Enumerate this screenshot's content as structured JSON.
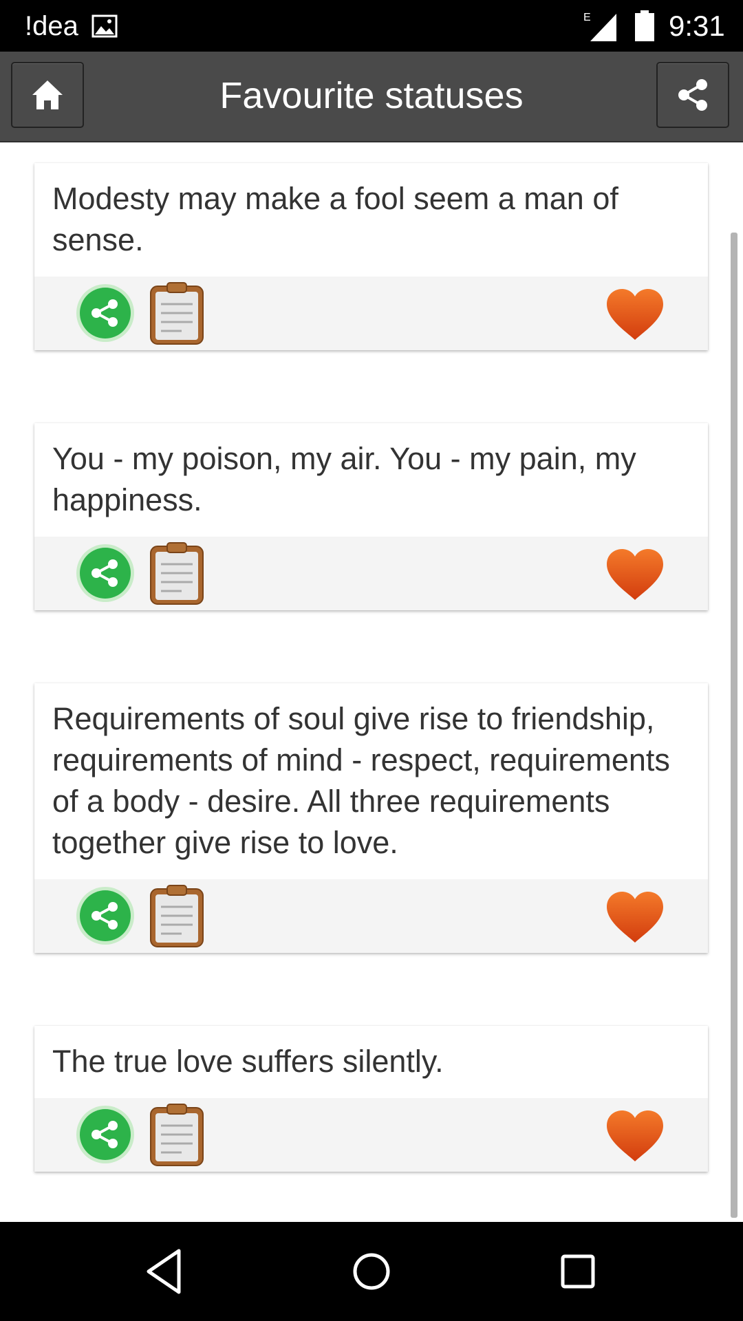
{
  "status_bar": {
    "carrier": "!dea",
    "network_type": "E",
    "time": "9:31",
    "icons": [
      "image-notification-icon",
      "signal-icon",
      "battery-icon"
    ]
  },
  "header": {
    "title": "Favourite statuses",
    "left_icon": "home-icon",
    "right_icon": "share-icon",
    "background_color": "#4a4a4a"
  },
  "statuses": [
    {
      "text": "Modesty may make a fool seem a man of sense."
    },
    {
      "text": "You - my poison, my air. You - my pain, my happiness."
    },
    {
      "text": "Requirements of soul give rise to friendship, requirements of mind - respect, requirements of a body - desire. All three requirements together give rise to love."
    },
    {
      "text": "The true love suffers silently."
    }
  ],
  "card_actions": {
    "icons": [
      "share-icon",
      "clipboard-icon",
      "heart-icon"
    ],
    "share_color": "#2db34a",
    "heart_color": "#e8561c"
  },
  "nav_bar": {
    "icons": [
      "back-icon",
      "home-circle-icon",
      "recents-icon"
    ]
  }
}
